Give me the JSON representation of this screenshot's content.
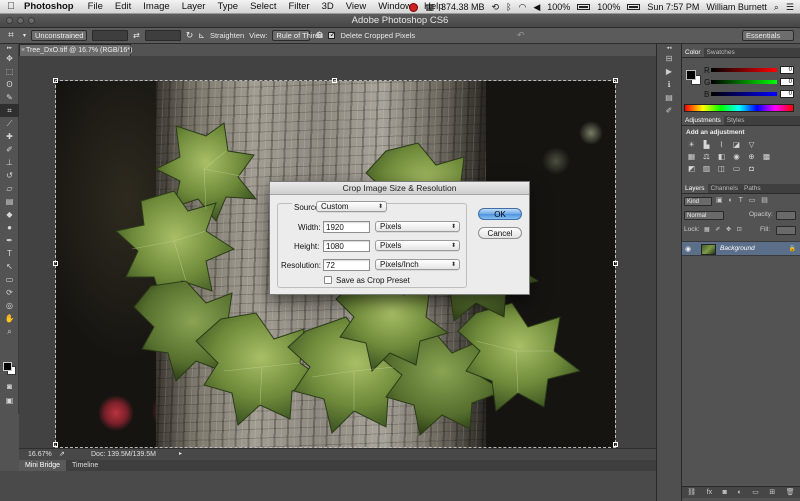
{
  "menubar": {
    "apple_icon": "apple-logo",
    "app_name": "Photoshop",
    "items": [
      "File",
      "Edit",
      "Image",
      "Layer",
      "Type",
      "Select",
      "Filter",
      "3D",
      "View",
      "Window",
      "Help"
    ],
    "memory": "374.38 MB",
    "battery_left": "100%",
    "battery_right": "100%",
    "clock": "Sun 7:57 PM",
    "user": "William Burnett"
  },
  "window": {
    "title": "Adobe Photoshop CS6"
  },
  "options": {
    "ratio": "Unconstrained",
    "straighten": "Straighten",
    "view_label": "View:",
    "view_value": "Rule of Thirds",
    "delete_cropped": "Delete Cropped Pixels",
    "delete_cropped_checked": true,
    "workspace": "Essentials"
  },
  "document": {
    "tab": "Tree_DxO.tiff @ 16.7% (RGB/16*)"
  },
  "status": {
    "zoom": "16.67%",
    "doc": "Doc: 139.5M/139.5M"
  },
  "bottom_tabs": [
    "Mini Bridge",
    "Timeline"
  ],
  "panels": {
    "color_tabs": [
      "Color",
      "Swatches"
    ],
    "rgb": [
      {
        "label": "R",
        "value": "0",
        "color": "#d84040"
      },
      {
        "label": "G",
        "value": "0",
        "color": "#40b040"
      },
      {
        "label": "B",
        "value": "0",
        "color": "#4050d0"
      }
    ],
    "adjust_tabs": [
      "Adjustments",
      "Styles"
    ],
    "adjust_title": "Add an adjustment",
    "layers_tabs": [
      "Layers",
      "Channels",
      "Paths"
    ],
    "kind_label": "Kind",
    "blend_mode": "Normal",
    "opacity_label": "Opacity:",
    "lock_label": "Lock:",
    "fill_label": "Fill:",
    "layer_name": "Background"
  },
  "dialog": {
    "title": "Crop Image Size & Resolution",
    "source_label": "Source:",
    "source_value": "Custom",
    "width_label": "Width:",
    "width_value": "1920",
    "width_unit": "Pixels",
    "height_label": "Height:",
    "height_value": "1080",
    "height_unit": "Pixels",
    "resolution_label": "Resolution:",
    "resolution_value": "72",
    "resolution_unit": "Pixels/Inch",
    "save_preset": "Save as Crop Preset",
    "ok": "OK",
    "cancel": "Cancel"
  },
  "colors": {
    "accent": "#4f92de",
    "ui_dark": "#535353",
    "canvas_bg": "#424242"
  }
}
